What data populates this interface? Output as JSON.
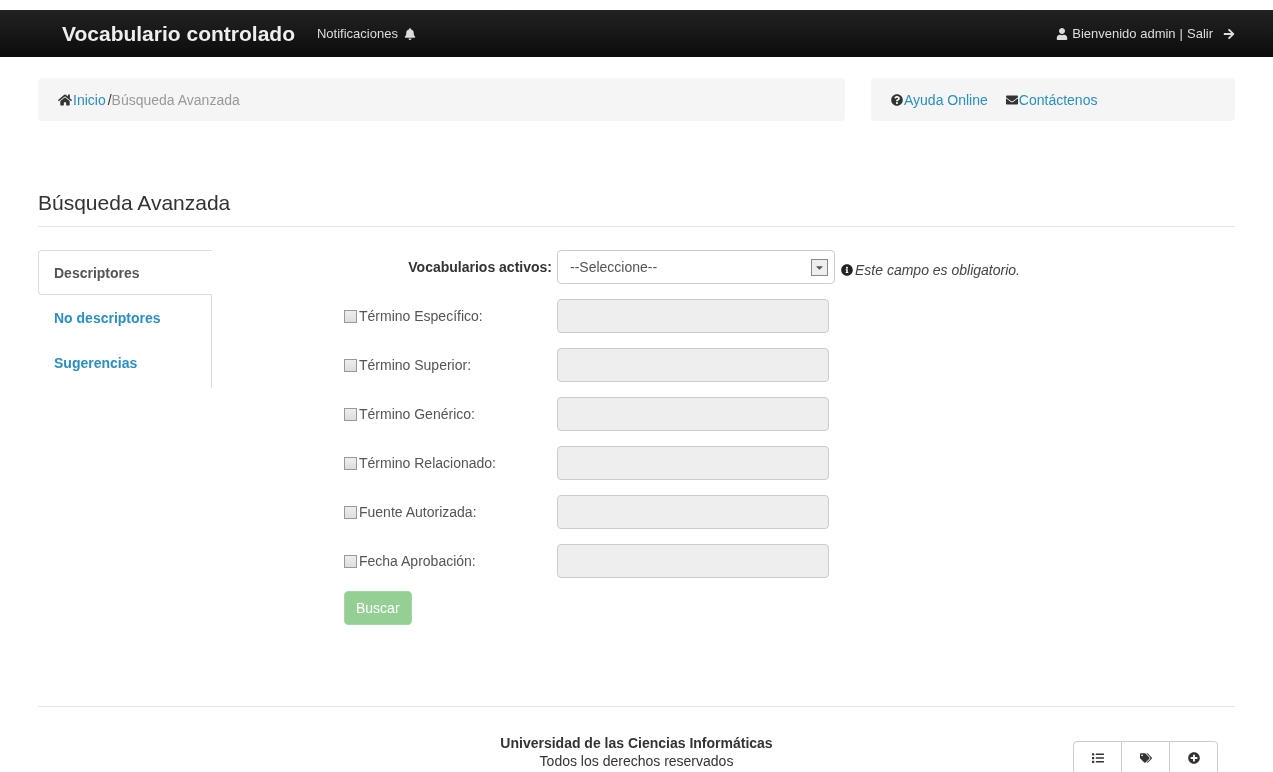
{
  "navbar": {
    "brand": "Vocabulario controlado",
    "notifications": "Notificaciones",
    "greeting": "Bienvenido admin",
    "separator": "|",
    "logout": "Salir"
  },
  "breadcrumb": {
    "items": [
      {
        "label": "Inicio",
        "kind": "link"
      },
      {
        "label": "/",
        "kind": "separator"
      },
      {
        "label": "Búsqueda Avanzada",
        "kind": "current"
      }
    ]
  },
  "help_links": [
    {
      "label": "Ayuda Online",
      "kind": "help"
    },
    {
      "label": "Contáctenos",
      "kind": "mail"
    }
  ],
  "page_title": "Búsqueda Avanzada",
  "tabs": [
    {
      "label": "Descriptores",
      "selected": true
    },
    {
      "label": "No descriptores",
      "selected": false
    },
    {
      "label": "Sugerencias",
      "selected": false
    }
  ],
  "form": {
    "select_label": "Vocabularios activos:",
    "select_value": "--Seleccione--",
    "hint": "Este campo es obligatorio.",
    "fields": [
      {
        "label": "Término Específico:",
        "checked": false
      },
      {
        "label": "Término Superior:",
        "checked": false
      },
      {
        "label": "Término Genérico:",
        "checked": false
      },
      {
        "label": "Término Relacionado:",
        "checked": false
      },
      {
        "label": "Fuente Autorizada:",
        "checked": false
      },
      {
        "label": "Fecha Aprobación:",
        "checked": false
      }
    ],
    "submit": {
      "label": "Buscar",
      "disabled": true
    }
  },
  "footer": {
    "institution": "Universidad de las Ciencias Informáticas",
    "rights": "Todos los derechos reservados",
    "buttons": [
      {
        "kind": "list"
      },
      {
        "kind": "tags"
      },
      {
        "kind": "plus"
      }
    ]
  }
}
